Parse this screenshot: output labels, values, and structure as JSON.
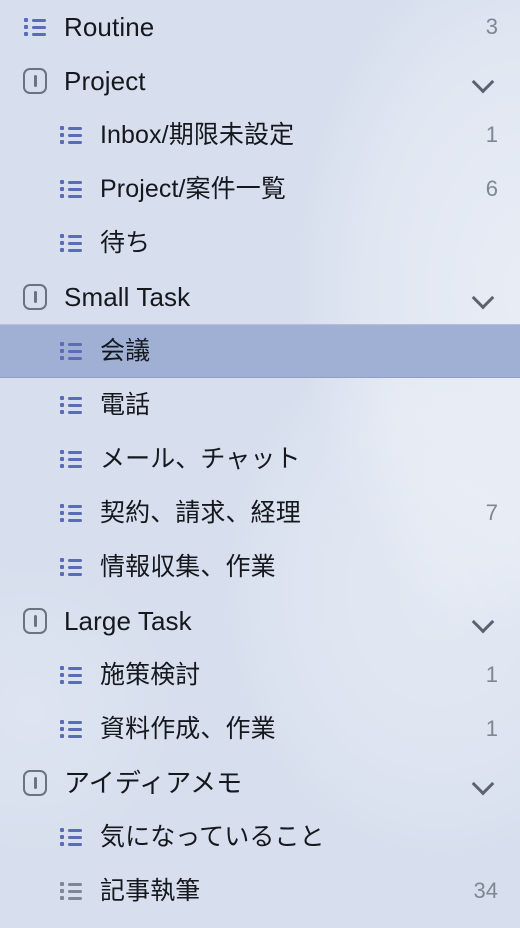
{
  "theme": {
    "background": "#d7dfee",
    "selected_background": "#a0b0d4",
    "icon_blue": "#5a6cb8",
    "icon_gray": "#7d8796",
    "label_color": "#15181d",
    "count_color": "#7f8793",
    "chevron_color": "#5c6270"
  },
  "sidebar": {
    "rows": [
      {
        "level": "header",
        "icon": "list-icon",
        "icon_color": "blue",
        "label": "Routine",
        "count": "3",
        "chevron": false,
        "selected": false
      },
      {
        "level": "header",
        "icon": "board-icon",
        "icon_color": "gray",
        "label": "Project",
        "count": "",
        "chevron": true,
        "selected": false
      },
      {
        "level": "child",
        "icon": "list-icon",
        "icon_color": "blue",
        "label": "Inbox/期限未設定",
        "count": "1",
        "chevron": false,
        "selected": false
      },
      {
        "level": "child",
        "icon": "list-icon",
        "icon_color": "blue",
        "label": "Project/案件一覧",
        "count": "6",
        "chevron": false,
        "selected": false
      },
      {
        "level": "child",
        "icon": "list-icon",
        "icon_color": "blue",
        "label": "待ち",
        "count": "",
        "chevron": false,
        "selected": false
      },
      {
        "level": "header",
        "icon": "board-icon",
        "icon_color": "gray",
        "label": "Small Task",
        "count": "",
        "chevron": true,
        "selected": false
      },
      {
        "level": "child",
        "icon": "list-icon",
        "icon_color": "blue",
        "label": "会議",
        "count": "",
        "chevron": false,
        "selected": true
      },
      {
        "level": "child",
        "icon": "list-icon",
        "icon_color": "blue",
        "label": "電話",
        "count": "",
        "chevron": false,
        "selected": false
      },
      {
        "level": "child",
        "icon": "list-icon",
        "icon_color": "blue",
        "label": "メール、チャット",
        "count": "",
        "chevron": false,
        "selected": false
      },
      {
        "level": "child",
        "icon": "list-icon",
        "icon_color": "blue",
        "label": "契約、請求、経理",
        "count": "7",
        "chevron": false,
        "selected": false
      },
      {
        "level": "child",
        "icon": "list-icon",
        "icon_color": "blue",
        "label": "情報収集、作業",
        "count": "",
        "chevron": false,
        "selected": false
      },
      {
        "level": "header",
        "icon": "board-icon",
        "icon_color": "gray",
        "label": "Large Task",
        "count": "",
        "chevron": true,
        "selected": false
      },
      {
        "level": "child",
        "icon": "list-icon",
        "icon_color": "blue",
        "label": "施策検討",
        "count": "1",
        "chevron": false,
        "selected": false
      },
      {
        "level": "child",
        "icon": "list-icon",
        "icon_color": "blue",
        "label": "資料作成、作業",
        "count": "1",
        "chevron": false,
        "selected": false
      },
      {
        "level": "header",
        "icon": "board-icon",
        "icon_color": "gray",
        "label": "アイディアメモ",
        "count": "",
        "chevron": true,
        "selected": false
      },
      {
        "level": "child",
        "icon": "list-icon",
        "icon_color": "blue",
        "label": "気になっていること",
        "count": "",
        "chevron": false,
        "selected": false
      },
      {
        "level": "child",
        "icon": "list-icon",
        "icon_color": "gray",
        "label": "記事執筆",
        "count": "34",
        "chevron": false,
        "selected": false
      }
    ]
  }
}
